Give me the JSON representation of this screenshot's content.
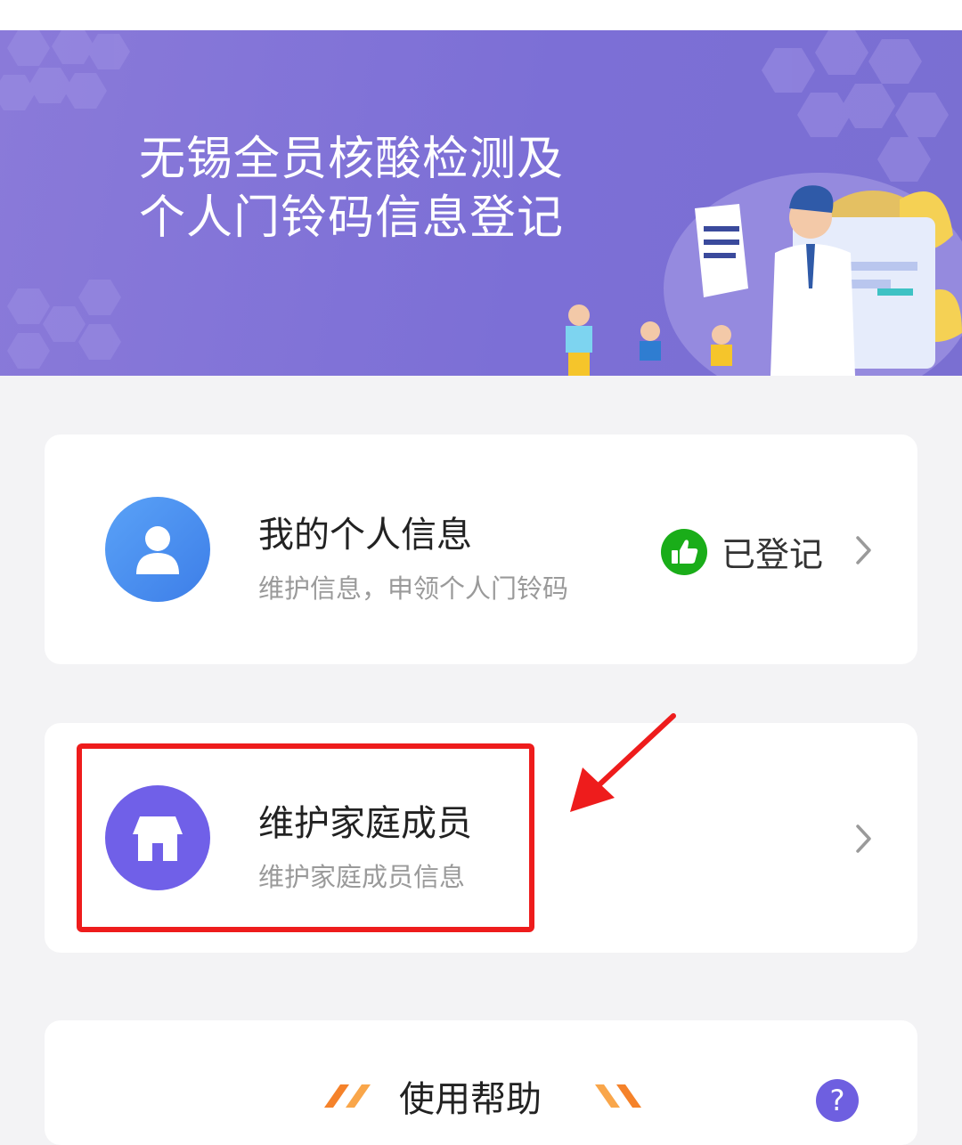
{
  "banner": {
    "title_line1": "无锡全员核酸检测及",
    "title_line2": "个人门铃码信息登记"
  },
  "personal_card": {
    "title": "我的个人信息",
    "subtitle": "维护信息，申领个人门铃码",
    "status": "已登记",
    "icon": "user-icon",
    "status_icon": "thumbs-up-icon",
    "status_color": "#1aad19"
  },
  "family_card": {
    "title": "维护家庭成员",
    "subtitle": "维护家庭成员信息",
    "icon": "house-icon"
  },
  "help_card": {
    "title": "使用帮助",
    "help_icon": "?"
  },
  "colors": {
    "banner": "#7c6fd6",
    "user_icon_bg": "#4a8ff0",
    "house_icon_bg": "#7060e8",
    "highlight": "#ee1c1c"
  }
}
